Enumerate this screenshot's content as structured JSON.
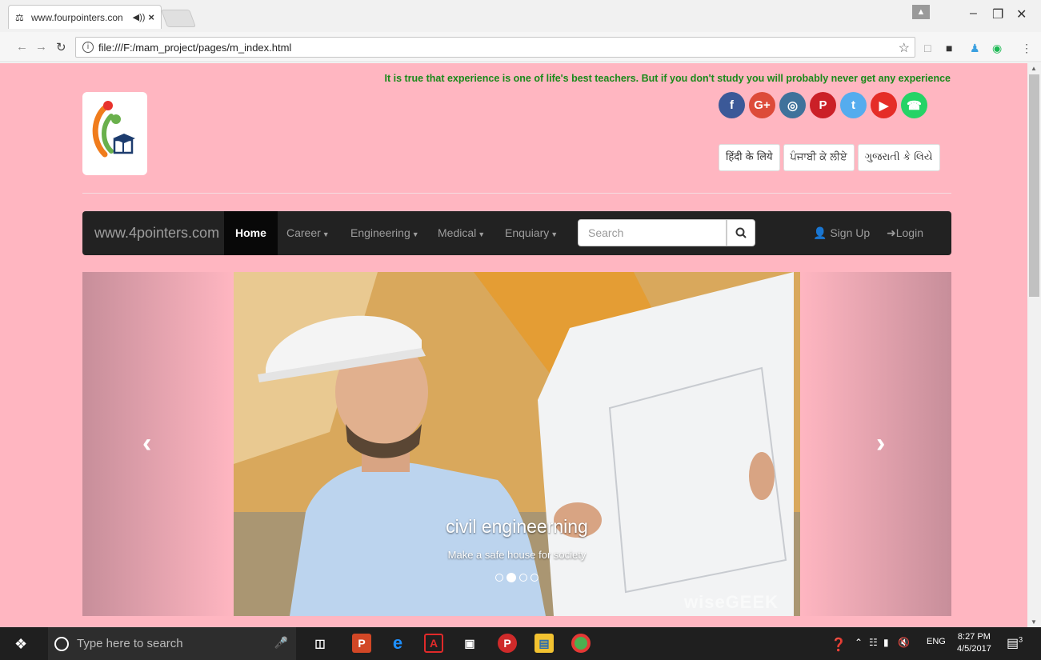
{
  "browser": {
    "tab_title": "www.fourpointers.con",
    "tab_audio": "◀))",
    "tab_close": "×",
    "url": "file:///F:/mam_project/pages/m_index.html",
    "window_minimize": "–",
    "window_maximize": "❐",
    "window_close": "✕"
  },
  "page": {
    "quote": "It is true that experience is one of life's best teachers. But if you don't study you will probably never get any experience",
    "socials": [
      {
        "name": "facebook",
        "glyph": "f",
        "color": "#3b5998"
      },
      {
        "name": "google-plus",
        "glyph": "G+",
        "color": "#dd4b39"
      },
      {
        "name": "instagram",
        "glyph": "◎",
        "color": "#3f729b"
      },
      {
        "name": "pinterest",
        "glyph": "P",
        "color": "#cb2027"
      },
      {
        "name": "twitter",
        "glyph": "t",
        "color": "#55acee"
      },
      {
        "name": "youtube",
        "glyph": "▶",
        "color": "#e52d27"
      },
      {
        "name": "whatsapp",
        "glyph": "☎",
        "color": "#25d366"
      }
    ],
    "languages": [
      "हिंदी के लिये",
      "ਪੰਜਾਬੀ ਕੇ ਲੀਏ",
      "ગુજરાતી કે લિયે"
    ]
  },
  "navbar": {
    "brand": "www.4pointers.com",
    "items": [
      {
        "label": "Home",
        "active": true
      },
      {
        "label": "Career",
        "dropdown": true
      },
      {
        "label": "Engineering",
        "dropdown": true
      },
      {
        "label": "Medical",
        "dropdown": true
      },
      {
        "label": "Enquiary",
        "dropdown": true
      }
    ],
    "search_placeholder": "Search",
    "signup": "Sign Up",
    "login": "Login"
  },
  "carousel": {
    "caption_title": "civil engineerning",
    "caption_subtitle": "Make a safe house for society",
    "active_index": 1,
    "slide_count": 4,
    "watermark": "wiseGEEK",
    "prev_glyph": "‹",
    "next_glyph": "›"
  },
  "taskbar": {
    "search_placeholder": "Type here to search",
    "language": "ENG",
    "time": "8:27 PM",
    "date": "4/5/2017",
    "notifications": "3"
  }
}
